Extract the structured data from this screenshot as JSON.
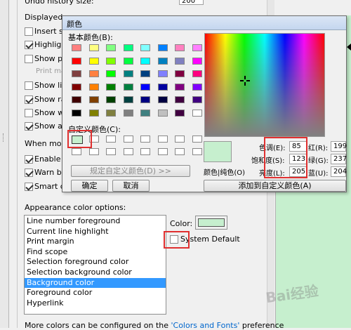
{
  "prefs": {
    "undo_history_label": "Undo history size:",
    "undo_history_value": "200",
    "displayed_label": "Displayed",
    "options": [
      {
        "label": "Insert sp",
        "checked": false
      },
      {
        "label": "Highlight",
        "checked": true
      },
      {
        "label": "Show pr",
        "checked": false
      },
      {
        "label": "Print ma",
        "checked": false,
        "disabled": true
      },
      {
        "label": "Show lin",
        "checked": false
      },
      {
        "label": "Show ra",
        "checked": true
      },
      {
        "label": "Show wh",
        "checked": false
      },
      {
        "label": "Show aft",
        "checked": true
      }
    ],
    "when_mouse_label": "When mou",
    "mouse_options": [
      {
        "label": "Enable c",
        "checked": true
      },
      {
        "label": "Warn be",
        "checked": true
      },
      {
        "label": "Smart ca",
        "checked": true
      }
    ],
    "appearance_label": "Appearance color options:",
    "appearance_items": [
      "Line number foreground",
      "Current line highlight",
      "Print margin",
      "Find scope",
      "Selection foreground color",
      "Selection background color",
      "Background color",
      "Foreground color",
      "Hyperlink"
    ],
    "selected_index": 6,
    "color_label": "Color:",
    "color_value": "#c6efce",
    "system_default_label": "System Default",
    "footer_text": "More colors can be configured on the ",
    "footer_link": "'Colors and Fonts'",
    "footer_tail": " preference"
  },
  "dialog": {
    "title": "颜色",
    "basic_colors_label": "基本颜色(B):",
    "basic_colors": [
      "#ff8080",
      "#ffff80",
      "#80ff80",
      "#00ff80",
      "#80ffff",
      "#0080ff",
      "#ff80c0",
      "#ff80ff",
      "#ff0000",
      "#ffff00",
      "#80ff00",
      "#00ff40",
      "#00ffff",
      "#0080c0",
      "#8080c0",
      "#ff00ff",
      "#804040",
      "#ff8040",
      "#00ff00",
      "#008080",
      "#004080",
      "#8080ff",
      "#800040",
      "#ff0080",
      "#800000",
      "#ff8000",
      "#008000",
      "#008040",
      "#0000ff",
      "#0000a0",
      "#800080",
      "#8000ff",
      "#400000",
      "#804000",
      "#004000",
      "#004040",
      "#000080",
      "#000040",
      "#400040",
      "#400080",
      "#000000",
      "#808000",
      "#808040",
      "#808080",
      "#408080",
      "#c0c0c0",
      "#400040",
      "#ffffff"
    ],
    "custom_colors_label": "自定义颜色(C):",
    "custom_colors": [
      "#c6efce",
      "#ffffff",
      "#ffffff",
      "#ffffff",
      "#ffffff",
      "#ffffff",
      "#ffffff",
      "#ffffff",
      "#ffffff",
      "#ffffff",
      "#ffffff",
      "#ffffff",
      "#ffffff",
      "#ffffff",
      "#ffffff",
      "#ffffff"
    ],
    "define_custom_label": "规定自定义颜色(D) >>",
    "ok_label": "确定",
    "cancel_label": "取消",
    "color_solid_label": "颜色|纯色(O)",
    "hue_label": "色调(E):",
    "hue": "85",
    "sat_label": "饱和度(S):",
    "sat": "123",
    "lum_label": "亮度(L):",
    "lum": "205",
    "red_label": "红(R):",
    "red": "199",
    "green_label": "绿(G):",
    "green": "237",
    "blue_label": "蓝(U):",
    "blue": "204",
    "add_custom_label": "添加到自定义颜色(A)",
    "preview_color": "#c6efce"
  }
}
